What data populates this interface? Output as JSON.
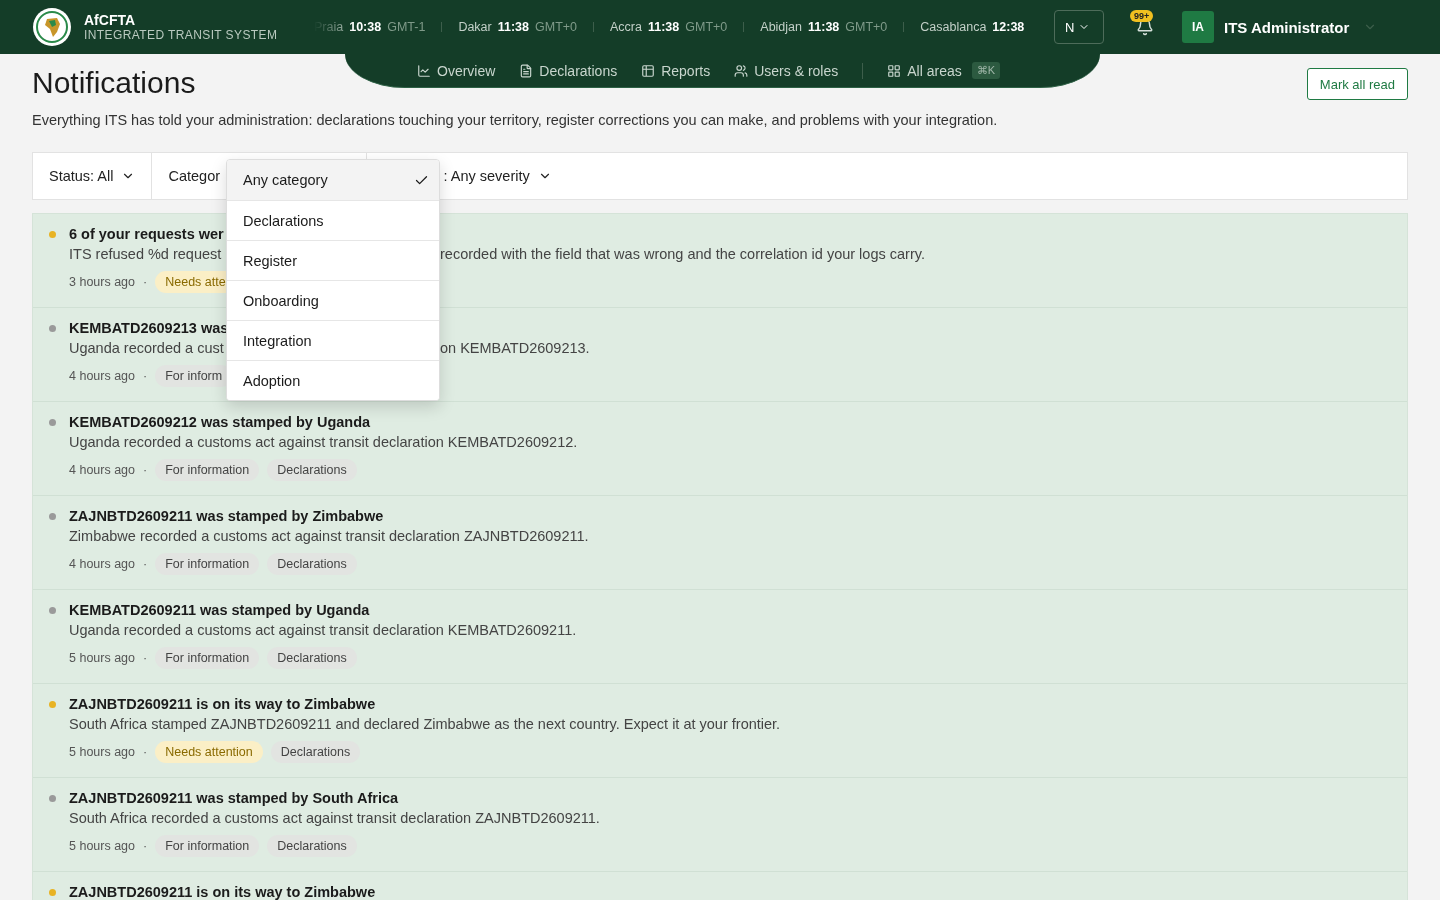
{
  "brand": {
    "name": "AfCFTA",
    "subtitle": "INTEGRATED TRANSIT SYSTEM"
  },
  "clocks": [
    {
      "city": "Praia",
      "time": "10:38",
      "zone": "GMT-1"
    },
    {
      "city": "Dakar",
      "time": "11:38",
      "zone": "GMT+0"
    },
    {
      "city": "Accra",
      "time": "11:38",
      "zone": "GMT+0"
    },
    {
      "city": "Abidjan",
      "time": "11:38",
      "zone": "GMT+0"
    },
    {
      "city": "Casablanca",
      "time": "12:38"
    }
  ],
  "language": {
    "label": "N"
  },
  "notifications_badge": "99+",
  "user": {
    "initials": "IA",
    "name": "ITS Administrator"
  },
  "nav": [
    {
      "label": "Overview"
    },
    {
      "label": "Declarations"
    },
    {
      "label": "Reports"
    },
    {
      "label": "Users & roles"
    }
  ],
  "all_areas": {
    "label": "All areas",
    "shortcut": "⌘K"
  },
  "page": {
    "title": "Notifications",
    "description": "Everything ITS has told your administration: declarations touching your territory, register corrections you can make, and problems with your integration.",
    "action": "Mark all read"
  },
  "filters": [
    {
      "label": "Status: All",
      "kind": "plain"
    },
    {
      "label": "Categor",
      "kind": "open"
    },
    {
      "label": ": Any severity",
      "kind": "covered"
    }
  ],
  "dropdown": [
    {
      "label": "Any category",
      "selected": true
    },
    {
      "label": "Declarations",
      "selected": false
    },
    {
      "label": "Register",
      "selected": false
    },
    {
      "label": "Onboarding",
      "selected": false
    },
    {
      "label": "Integration",
      "selected": false
    },
    {
      "label": "Adoption",
      "selected": false
    }
  ],
  "notifications": [
    {
      "title": "6 of your requests wer",
      "body": [
        "ITS refused %d request",
        "recorded with the field that was wrong and the correlation id your logs carry."
      ],
      "time": "3 hours ago",
      "separator": "·",
      "color": "#e8b324",
      "tags": [
        {
          "label": "Needs atte",
          "kind": "attention"
        }
      ]
    },
    {
      "title": "KEMBATD2609213 was",
      "body": [
        "Uganda recorded a cust",
        "on KEMBATD2609213."
      ],
      "time": "4 hours ago",
      "separator": "·",
      "color": "#9a9a9a",
      "tags": [
        {
          "label": "For inform",
          "kind": "info"
        }
      ]
    },
    {
      "title": "KEMBATD2609212 was stamped by Uganda",
      "body": [
        "Uganda recorded a customs act against transit declaration KEMBATD2609212."
      ],
      "time": "4 hours ago",
      "separator": "·",
      "color": "#9a9a9a",
      "tags": [
        {
          "label": "For information",
          "kind": "info"
        },
        {
          "label": "Declarations",
          "kind": "info"
        }
      ]
    },
    {
      "title": "ZAJNBTD2609211 was stamped by Zimbabwe",
      "body": [
        "Zimbabwe recorded a customs act against transit declaration ZAJNBTD2609211."
      ],
      "time": "4 hours ago",
      "separator": "·",
      "color": "#9a9a9a",
      "tags": [
        {
          "label": "For information",
          "kind": "info"
        },
        {
          "label": "Declarations",
          "kind": "info"
        }
      ]
    },
    {
      "title": "KEMBATD2609211 was stamped by Uganda",
      "body": [
        "Uganda recorded a customs act against transit declaration KEMBATD2609211."
      ],
      "time": "5 hours ago",
      "separator": "·",
      "color": "#9a9a9a",
      "tags": [
        {
          "label": "For information",
          "kind": "info"
        },
        {
          "label": "Declarations",
          "kind": "info"
        }
      ]
    },
    {
      "title": "ZAJNBTD2609211 is on its way to Zimbabwe",
      "body": [
        "South Africa stamped ZAJNBTD2609211 and declared Zimbabwe as the next country. Expect it at your frontier."
      ],
      "time": "5 hours ago",
      "separator": "·",
      "color": "#e8b324",
      "tags": [
        {
          "label": "Needs attention",
          "kind": "attention"
        },
        {
          "label": "Declarations",
          "kind": "info"
        }
      ]
    },
    {
      "title": "ZAJNBTD2609211 was stamped by South Africa",
      "body": [
        "South Africa recorded a customs act against transit declaration ZAJNBTD2609211."
      ],
      "time": "5 hours ago",
      "separator": "·",
      "color": "#9a9a9a",
      "tags": [
        {
          "label": "For information",
          "kind": "info"
        },
        {
          "label": "Declarations",
          "kind": "info"
        }
      ]
    },
    {
      "title": "ZAJNBTD2609211 is on its way to Zimbabwe",
      "color": "#e8b324"
    }
  ]
}
